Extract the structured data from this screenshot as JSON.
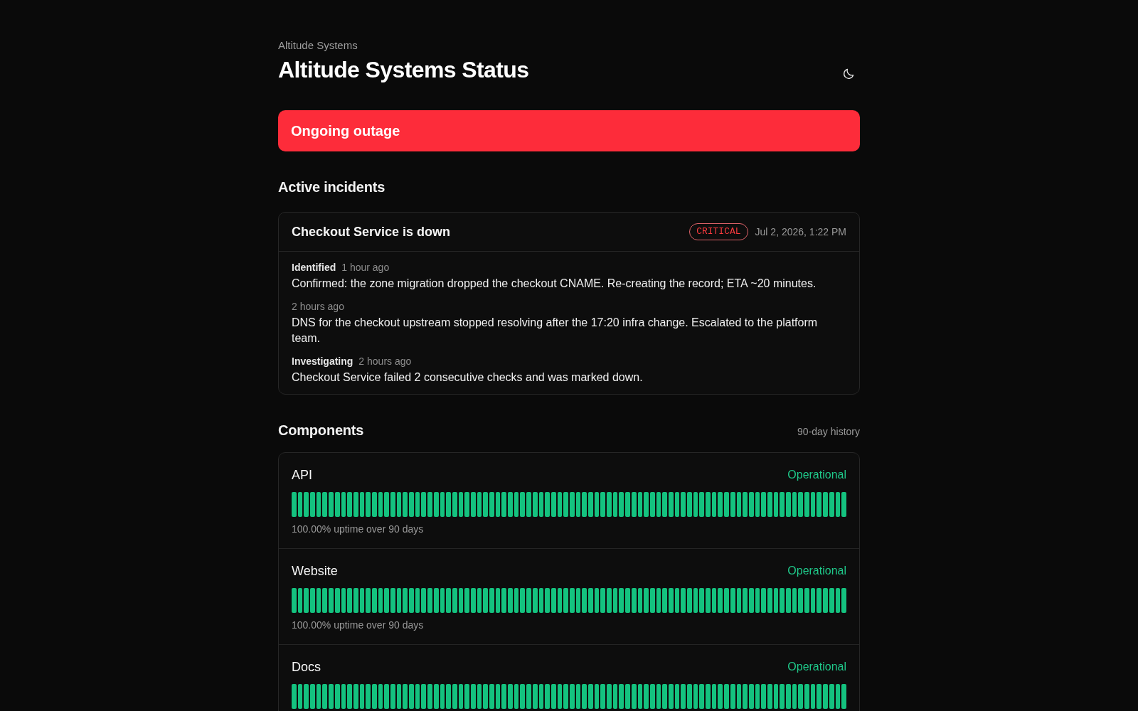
{
  "header": {
    "brand": "Altitude Systems",
    "title": "Altitude Systems Status"
  },
  "banner": {
    "kind": "outage",
    "text": "Ongoing outage"
  },
  "incidents": {
    "heading": "Active incidents",
    "items": [
      {
        "title": "Checkout Service is down",
        "kind": "critical",
        "severity": "CRITICAL",
        "date": "Jul 2, 2026, 1:22 PM",
        "updates": [
          {
            "status": "Identified",
            "time": "1 hour ago",
            "text": "Confirmed: the zone migration dropped the checkout CNAME. Re-creating the record; ETA ~20 minutes."
          },
          {
            "time": "2 hours ago",
            "text": "DNS for the checkout upstream stopped resolving after the 17:20 infra change. Escalated to the platform team."
          },
          {
            "status": "Investigating",
            "time": "2 hours ago",
            "text": "Checkout Service failed 2 consecutive checks and was marked down."
          }
        ]
      }
    ]
  },
  "components": {
    "heading": "Components",
    "note": "90-day history",
    "items": [
      {
        "name": "API",
        "status": "Operational",
        "kind": "operational",
        "days": [
          {
            "color": "#14c27f"
          },
          {
            "color": "#14c27f"
          },
          {
            "color": "#14c27f"
          },
          {
            "color": "#14c27f"
          },
          {
            "color": "#14c27f"
          },
          {
            "color": "#14c27f"
          },
          {
            "color": "#14c27f"
          },
          {
            "color": "#14c27f"
          },
          {
            "color": "#14c27f"
          },
          {
            "color": "#14c27f"
          },
          {
            "color": "#14c27f"
          },
          {
            "color": "#14c27f"
          },
          {
            "color": "#14c27f"
          },
          {
            "color": "#14c27f"
          },
          {
            "color": "#14c27f"
          },
          {
            "color": "#14c27f"
          },
          {
            "color": "#14c27f"
          },
          {
            "color": "#14c27f"
          },
          {
            "color": "#14c27f"
          },
          {
            "color": "#14c27f"
          },
          {
            "color": "#14c27f"
          },
          {
            "color": "#14c27f"
          },
          {
            "color": "#14c27f"
          },
          {
            "color": "#14c27f"
          },
          {
            "color": "#14c27f"
          },
          {
            "color": "#14c27f"
          },
          {
            "color": "#14c27f"
          },
          {
            "color": "#14c27f"
          },
          {
            "color": "#14c27f"
          },
          {
            "color": "#14c27f"
          },
          {
            "color": "#14c27f"
          },
          {
            "color": "#14c27f"
          },
          {
            "color": "#14c27f"
          },
          {
            "color": "#14c27f"
          },
          {
            "color": "#14c27f"
          },
          {
            "color": "#14c27f"
          },
          {
            "color": "#14c27f"
          },
          {
            "color": "#14c27f"
          },
          {
            "color": "#14c27f"
          },
          {
            "color": "#14c27f"
          },
          {
            "color": "#14c27f"
          },
          {
            "color": "#14c27f"
          },
          {
            "color": "#14c27f"
          },
          {
            "color": "#14c27f"
          },
          {
            "color": "#14c27f"
          },
          {
            "color": "#14c27f"
          },
          {
            "color": "#14c27f"
          },
          {
            "color": "#14c27f"
          },
          {
            "color": "#14c27f"
          },
          {
            "color": "#14c27f"
          },
          {
            "color": "#14c27f"
          },
          {
            "color": "#14c27f"
          },
          {
            "color": "#14c27f"
          },
          {
            "color": "#14c27f"
          },
          {
            "color": "#14c27f"
          },
          {
            "color": "#14c27f"
          },
          {
            "color": "#14c27f"
          },
          {
            "color": "#14c27f"
          },
          {
            "color": "#14c27f"
          },
          {
            "color": "#14c27f"
          },
          {
            "color": "#14c27f"
          },
          {
            "color": "#14c27f"
          },
          {
            "color": "#14c27f"
          },
          {
            "color": "#14c27f"
          },
          {
            "color": "#14c27f"
          },
          {
            "color": "#14c27f"
          },
          {
            "color": "#14c27f"
          },
          {
            "color": "#14c27f"
          },
          {
            "color": "#14c27f"
          },
          {
            "color": "#14c27f"
          },
          {
            "color": "#14c27f"
          },
          {
            "color": "#14c27f"
          },
          {
            "color": "#14c27f"
          },
          {
            "color": "#14c27f"
          },
          {
            "color": "#14c27f"
          },
          {
            "color": "#14c27f"
          },
          {
            "color": "#14c27f"
          },
          {
            "color": "#14c27f"
          },
          {
            "color": "#14c27f"
          },
          {
            "color": "#14c27f"
          },
          {
            "color": "#14c27f"
          },
          {
            "color": "#14c27f"
          },
          {
            "color": "#14c27f"
          },
          {
            "color": "#14c27f"
          },
          {
            "color": "#14c27f"
          },
          {
            "color": "#14c27f"
          },
          {
            "color": "#14c27f"
          },
          {
            "color": "#14c27f"
          },
          {
            "color": "#14c27f"
          },
          {
            "color": "#14c27f"
          }
        ],
        "uptime": "100.00% uptime over 90 days"
      },
      {
        "name": "Website",
        "status": "Operational",
        "kind": "operational",
        "days": [
          {
            "color": "#14c27f"
          },
          {
            "color": "#14c27f"
          },
          {
            "color": "#14c27f"
          },
          {
            "color": "#14c27f"
          },
          {
            "color": "#14c27f"
          },
          {
            "color": "#14c27f"
          },
          {
            "color": "#14c27f"
          },
          {
            "color": "#14c27f"
          },
          {
            "color": "#14c27f"
          },
          {
            "color": "#14c27f"
          },
          {
            "color": "#14c27f"
          },
          {
            "color": "#14c27f"
          },
          {
            "color": "#14c27f"
          },
          {
            "color": "#14c27f"
          },
          {
            "color": "#14c27f"
          },
          {
            "color": "#14c27f"
          },
          {
            "color": "#14c27f"
          },
          {
            "color": "#14c27f"
          },
          {
            "color": "#14c27f"
          },
          {
            "color": "#14c27f"
          },
          {
            "color": "#14c27f"
          },
          {
            "color": "#14c27f"
          },
          {
            "color": "#14c27f"
          },
          {
            "color": "#14c27f"
          },
          {
            "color": "#14c27f"
          },
          {
            "color": "#14c27f"
          },
          {
            "color": "#14c27f"
          },
          {
            "color": "#14c27f"
          },
          {
            "color": "#14c27f"
          },
          {
            "color": "#14c27f"
          },
          {
            "color": "#14c27f"
          },
          {
            "color": "#14c27f"
          },
          {
            "color": "#14c27f"
          },
          {
            "color": "#14c27f"
          },
          {
            "color": "#14c27f"
          },
          {
            "color": "#14c27f"
          },
          {
            "color": "#14c27f"
          },
          {
            "color": "#14c27f"
          },
          {
            "color": "#14c27f"
          },
          {
            "color": "#14c27f"
          },
          {
            "color": "#14c27f"
          },
          {
            "color": "#14c27f"
          },
          {
            "color": "#14c27f"
          },
          {
            "color": "#14c27f"
          },
          {
            "color": "#14c27f"
          },
          {
            "color": "#14c27f"
          },
          {
            "color": "#14c27f"
          },
          {
            "color": "#14c27f"
          },
          {
            "color": "#14c27f"
          },
          {
            "color": "#14c27f"
          },
          {
            "color": "#14c27f"
          },
          {
            "color": "#14c27f"
          },
          {
            "color": "#14c27f"
          },
          {
            "color": "#14c27f"
          },
          {
            "color": "#14c27f"
          },
          {
            "color": "#14c27f"
          },
          {
            "color": "#14c27f"
          },
          {
            "color": "#14c27f"
          },
          {
            "color": "#14c27f"
          },
          {
            "color": "#14c27f"
          },
          {
            "color": "#14c27f"
          },
          {
            "color": "#14c27f"
          },
          {
            "color": "#14c27f"
          },
          {
            "color": "#14c27f"
          },
          {
            "color": "#14c27f"
          },
          {
            "color": "#14c27f"
          },
          {
            "color": "#14c27f"
          },
          {
            "color": "#14c27f"
          },
          {
            "color": "#14c27f"
          },
          {
            "color": "#14c27f"
          },
          {
            "color": "#14c27f"
          },
          {
            "color": "#14c27f"
          },
          {
            "color": "#14c27f"
          },
          {
            "color": "#14c27f"
          },
          {
            "color": "#14c27f"
          },
          {
            "color": "#14c27f"
          },
          {
            "color": "#14c27f"
          },
          {
            "color": "#14c27f"
          },
          {
            "color": "#14c27f"
          },
          {
            "color": "#14c27f"
          },
          {
            "color": "#14c27f"
          },
          {
            "color": "#14c27f"
          },
          {
            "color": "#14c27f"
          },
          {
            "color": "#14c27f"
          },
          {
            "color": "#14c27f"
          },
          {
            "color": "#14c27f"
          },
          {
            "color": "#14c27f"
          },
          {
            "color": "#14c27f"
          },
          {
            "color": "#14c27f"
          },
          {
            "color": "#14c27f"
          }
        ],
        "uptime": "100.00% uptime over 90 days"
      },
      {
        "name": "Docs",
        "status": "Operational",
        "kind": "operational",
        "days": [
          {
            "color": "#14c27f"
          },
          {
            "color": "#14c27f"
          },
          {
            "color": "#14c27f"
          },
          {
            "color": "#14c27f"
          },
          {
            "color": "#14c27f"
          },
          {
            "color": "#14c27f"
          },
          {
            "color": "#14c27f"
          },
          {
            "color": "#14c27f"
          },
          {
            "color": "#14c27f"
          },
          {
            "color": "#14c27f"
          },
          {
            "color": "#14c27f"
          },
          {
            "color": "#14c27f"
          },
          {
            "color": "#14c27f"
          },
          {
            "color": "#14c27f"
          },
          {
            "color": "#14c27f"
          },
          {
            "color": "#14c27f"
          },
          {
            "color": "#14c27f"
          },
          {
            "color": "#14c27f"
          },
          {
            "color": "#14c27f"
          },
          {
            "color": "#14c27f"
          },
          {
            "color": "#14c27f"
          },
          {
            "color": "#14c27f"
          },
          {
            "color": "#14c27f"
          },
          {
            "color": "#14c27f"
          },
          {
            "color": "#14c27f"
          },
          {
            "color": "#14c27f"
          },
          {
            "color": "#14c27f"
          },
          {
            "color": "#14c27f"
          },
          {
            "color": "#14c27f"
          },
          {
            "color": "#14c27f"
          },
          {
            "color": "#14c27f"
          },
          {
            "color": "#14c27f"
          },
          {
            "color": "#14c27f"
          },
          {
            "color": "#14c27f"
          },
          {
            "color": "#14c27f"
          },
          {
            "color": "#14c27f"
          },
          {
            "color": "#14c27f"
          },
          {
            "color": "#14c27f"
          },
          {
            "color": "#14c27f"
          },
          {
            "color": "#14c27f"
          },
          {
            "color": "#14c27f"
          },
          {
            "color": "#14c27f"
          },
          {
            "color": "#14c27f"
          },
          {
            "color": "#14c27f"
          },
          {
            "color": "#14c27f"
          },
          {
            "color": "#14c27f"
          },
          {
            "color": "#14c27f"
          },
          {
            "color": "#14c27f"
          },
          {
            "color": "#14c27f"
          },
          {
            "color": "#14c27f"
          },
          {
            "color": "#14c27f"
          },
          {
            "color": "#14c27f"
          },
          {
            "color": "#14c27f"
          },
          {
            "color": "#14c27f"
          },
          {
            "color": "#14c27f"
          },
          {
            "color": "#14c27f"
          },
          {
            "color": "#14c27f"
          },
          {
            "color": "#14c27f"
          },
          {
            "color": "#14c27f"
          },
          {
            "color": "#14c27f"
          },
          {
            "color": "#14c27f"
          },
          {
            "color": "#14c27f"
          },
          {
            "color": "#14c27f"
          },
          {
            "color": "#14c27f"
          },
          {
            "color": "#14c27f"
          },
          {
            "color": "#14c27f"
          },
          {
            "color": "#14c27f"
          },
          {
            "color": "#14c27f"
          },
          {
            "color": "#14c27f"
          },
          {
            "color": "#14c27f"
          },
          {
            "color": "#14c27f"
          },
          {
            "color": "#14c27f"
          },
          {
            "color": "#14c27f"
          },
          {
            "color": "#14c27f"
          },
          {
            "color": "#14c27f"
          },
          {
            "color": "#14c27f"
          },
          {
            "color": "#14c27f"
          },
          {
            "color": "#14c27f"
          },
          {
            "color": "#14c27f"
          },
          {
            "color": "#14c27f"
          },
          {
            "color": "#14c27f"
          },
          {
            "color": "#14c27f"
          },
          {
            "color": "#14c27f"
          },
          {
            "color": "#14c27f"
          },
          {
            "color": "#14c27f"
          },
          {
            "color": "#14c27f"
          },
          {
            "color": "#14c27f"
          },
          {
            "color": "#14c27f"
          },
          {
            "color": "#14c27f"
          },
          {
            "color": "#14c27f"
          }
        ]
      }
    ]
  }
}
